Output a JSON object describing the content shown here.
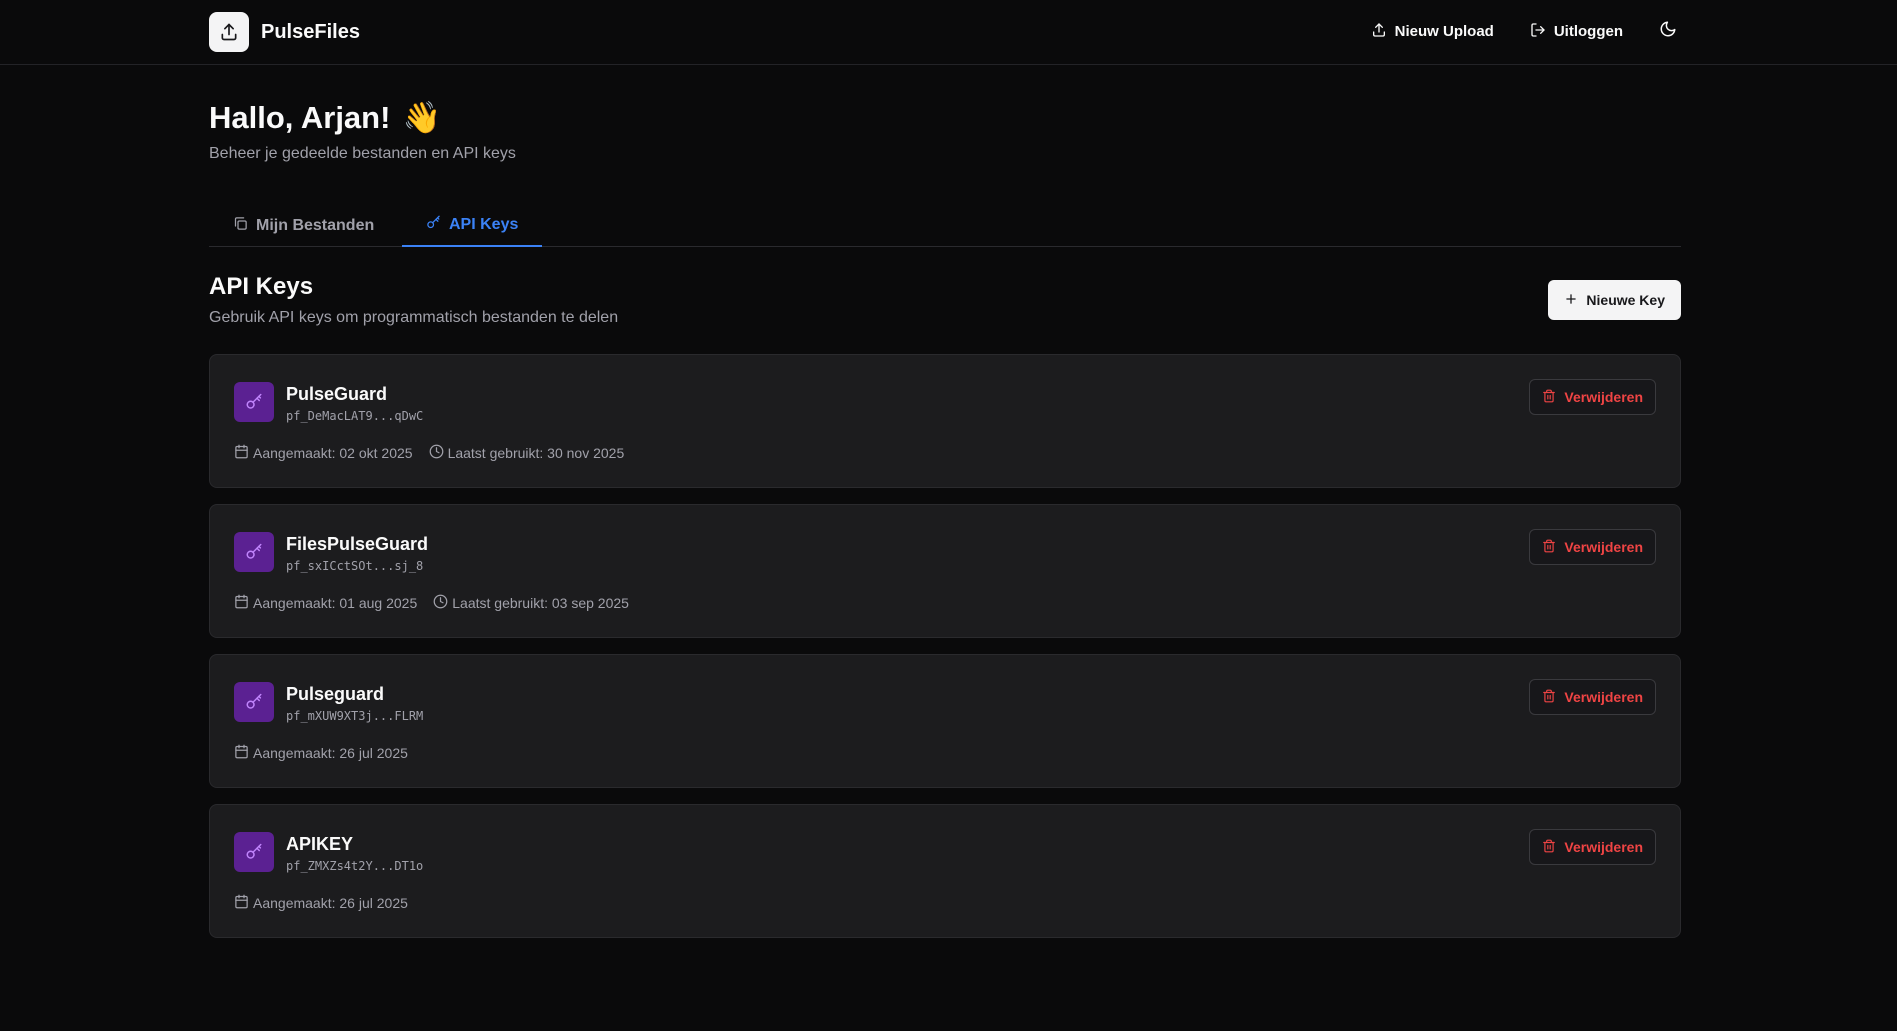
{
  "header": {
    "app_name": "PulseFiles",
    "nav": {
      "upload_label": "Nieuw Upload",
      "logout_label": "Uitloggen"
    }
  },
  "welcome": {
    "greeting": "Hallo, Arjan!",
    "emoji": "👋",
    "subtitle": "Beheer je gedeelde bestanden en API keys"
  },
  "tabs": [
    {
      "label": "Mijn Bestanden",
      "icon": "copy-icon",
      "active": false
    },
    {
      "label": "API Keys",
      "icon": "key-icon",
      "active": true
    }
  ],
  "api_keys_section": {
    "title": "API Keys",
    "subtitle": "Gebruik API keys om programmatisch bestanden te delen",
    "new_key_label": "Nieuwe Key"
  },
  "keys": [
    {
      "name": "PulseGuard",
      "value": "pf_DeMacLAT9...qDwC",
      "created": "Aangemaakt: 02 okt 2025",
      "last_used": "Laatst gebruikt: 30 nov 2025",
      "delete_label": "Verwijderen"
    },
    {
      "name": "FilesPulseGuard",
      "value": "pf_sxICctSOt...sj_8",
      "created": "Aangemaakt: 01 aug 2025",
      "last_used": "Laatst gebruikt: 03 sep 2025",
      "delete_label": "Verwijderen"
    },
    {
      "name": "Pulseguard",
      "value": "pf_mXUW9XT3j...FLRM",
      "created": "Aangemaakt: 26 jul 2025",
      "last_used": "",
      "delete_label": "Verwijderen"
    },
    {
      "name": "APIKEY",
      "value": "pf_ZMXZs4t2Y...DT1o",
      "created": "Aangemaakt: 26 jul 2025",
      "last_used": "",
      "delete_label": "Verwijderen"
    }
  ],
  "colors": {
    "accent": "#3b82f6",
    "danger": "#ef4444",
    "key_icon_bg": "#5b2192",
    "key_icon_fg": "#c084fc",
    "background": "#0a0a0b",
    "card": "#1c1c1e"
  }
}
